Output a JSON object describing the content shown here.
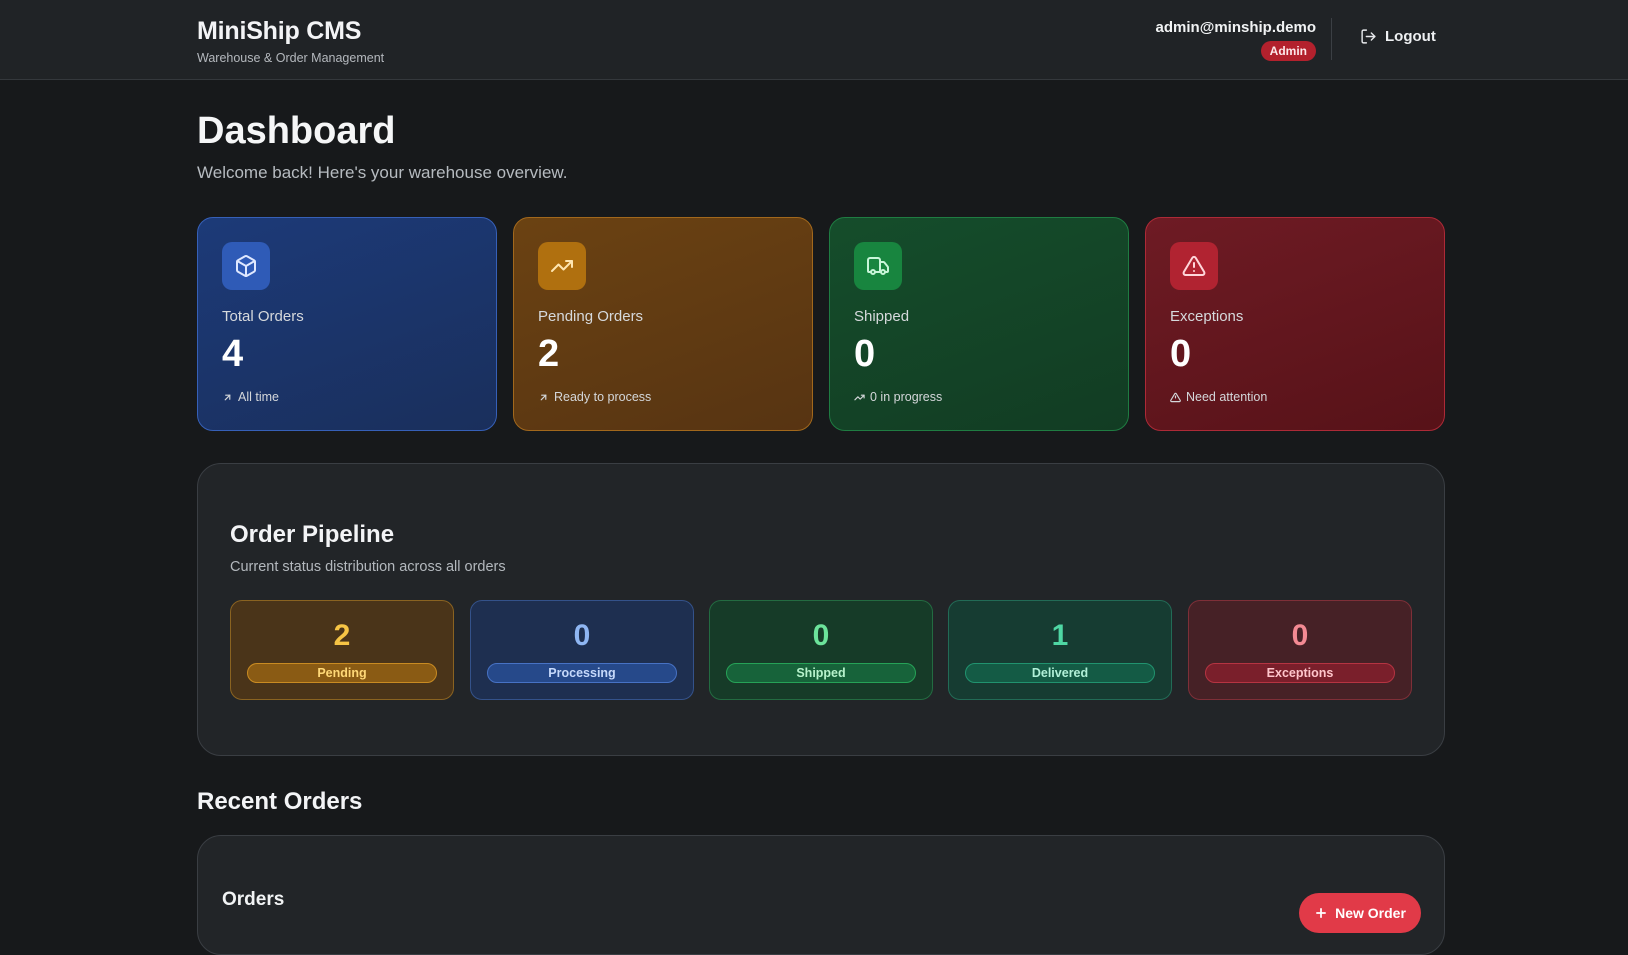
{
  "header": {
    "app_title": "MiniShip CMS",
    "app_subtitle": "Warehouse & Order Management",
    "user_email": "admin@minship.demo",
    "user_role": "Admin",
    "logout_label": "Logout"
  },
  "page": {
    "title": "Dashboard",
    "subtitle": "Welcome back! Here's your warehouse overview."
  },
  "stats": [
    {
      "label": "Total Orders",
      "value": "4",
      "footer": "All time",
      "icon": "package-icon",
      "color": "#2f5bb7"
    },
    {
      "label": "Pending Orders",
      "value": "2",
      "footer": "Ready to process",
      "icon": "trending-up-icon",
      "color": "#b0700f"
    },
    {
      "label": "Shipped",
      "value": "0",
      "footer": "0 in progress",
      "icon": "truck-icon",
      "color": "#18853f"
    },
    {
      "label": "Exceptions",
      "value": "0",
      "footer": "Need attention",
      "icon": "alert-triangle-icon",
      "color": "#b12331"
    }
  ],
  "pipeline": {
    "title": "Order Pipeline",
    "subtitle": "Current status distribution across all orders",
    "stages": [
      {
        "count": "2",
        "label": "Pending",
        "color": "#f6c445"
      },
      {
        "count": "0",
        "label": "Processing",
        "color": "#8fb6f2"
      },
      {
        "count": "0",
        "label": "Shipped",
        "color": "#6ce39b"
      },
      {
        "count": "1",
        "label": "Delivered",
        "color": "#4fd7a4"
      },
      {
        "count": "0",
        "label": "Exceptions",
        "color": "#f38a93"
      }
    ]
  },
  "recent_orders": {
    "section_title": "Recent Orders",
    "card_title": "Orders",
    "new_order_label": "New Order"
  }
}
